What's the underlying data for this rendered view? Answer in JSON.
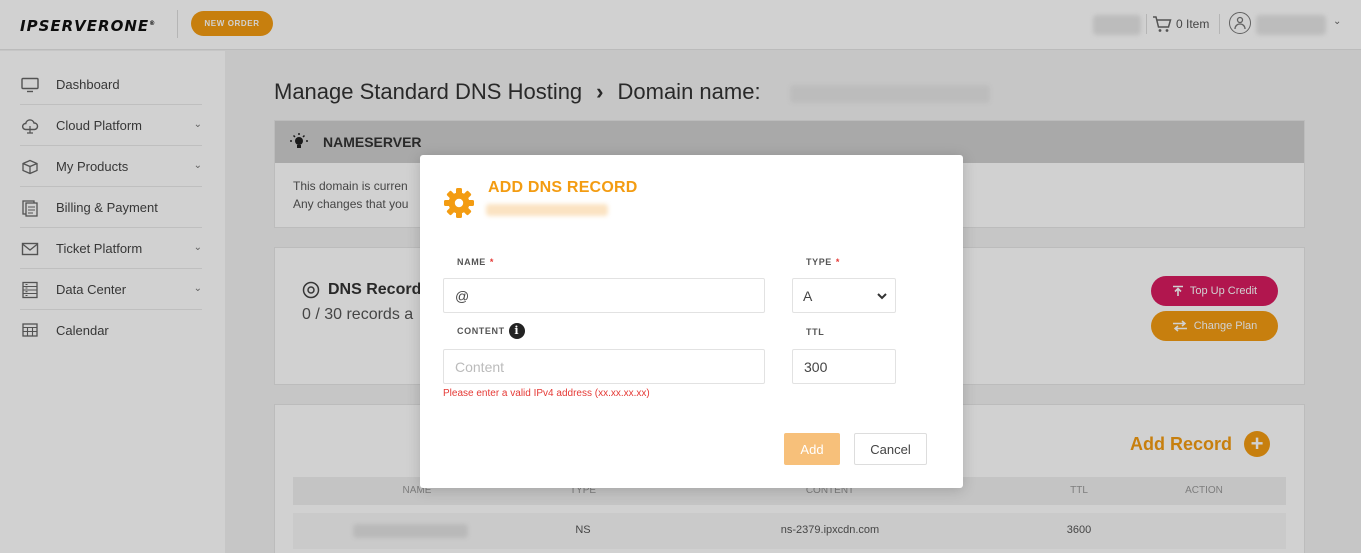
{
  "header": {
    "logo_text": "IPSERVERONE",
    "logo_mark": "®",
    "new_order_label": "NEW ORDER",
    "cart_label": "0 Item",
    "user_chevron": "⌄"
  },
  "sidebar": {
    "items": [
      {
        "label": "Dashboard",
        "icon": "monitor-icon",
        "has_submenu": false
      },
      {
        "label": "Cloud Platform",
        "icon": "cloud-icon",
        "has_submenu": true
      },
      {
        "label": "My Products",
        "icon": "box-icon",
        "has_submenu": true
      },
      {
        "label": "Billing & Payment",
        "icon": "billing-icon",
        "has_submenu": false
      },
      {
        "label": "Ticket Platform",
        "icon": "mail-icon",
        "has_submenu": true
      },
      {
        "label": "Data Center",
        "icon": "server-icon",
        "has_submenu": true
      },
      {
        "label": "Calendar",
        "icon": "calendar-icon",
        "has_submenu": false
      }
    ],
    "chevron": "⌄"
  },
  "main": {
    "page_title": "Manage Standard DNS Hosting",
    "title_separator": "›",
    "domain_label": "Domain name:",
    "nameserver": {
      "heading": "NAMESERVER",
      "line1": "This domain is curren",
      "line2": "Any changes that you"
    },
    "dns_records": {
      "title": "DNS Record",
      "subtitle": "0 / 30 records a",
      "topup_label": "Top Up Credit",
      "change_plan_label": "Change Plan"
    },
    "records_table": {
      "add_record_label": "Add Record",
      "add_record_plus": "+",
      "columns": [
        "NAME",
        "TYPE",
        "CONTENT",
        "TTL",
        "ACTION"
      ],
      "rows": [
        {
          "name": "",
          "type": "NS",
          "content": "ns-2379.ipxcdn.com",
          "ttl": "3600",
          "action": ""
        }
      ]
    }
  },
  "modal": {
    "title": "ADD DNS RECORD",
    "name_label": "NAME",
    "type_label": "TYPE",
    "required_mark": "*",
    "content_label": "CONTENT",
    "content_info": "i",
    "ttl_label": "TTL",
    "name_value": "@",
    "type_value": "A",
    "content_value": "",
    "content_placeholder": "Content",
    "ttl_value": "300",
    "error_message": "Please enter a valid IPv4 address (xx.xx.xx.xx)",
    "add_label": "Add",
    "cancel_label": "Cancel"
  },
  "colors": {
    "accent_orange": "#f39c12",
    "add_disabled": "#f7c07a",
    "topup_pink": "#d81b60",
    "error_red": "#e53935"
  }
}
